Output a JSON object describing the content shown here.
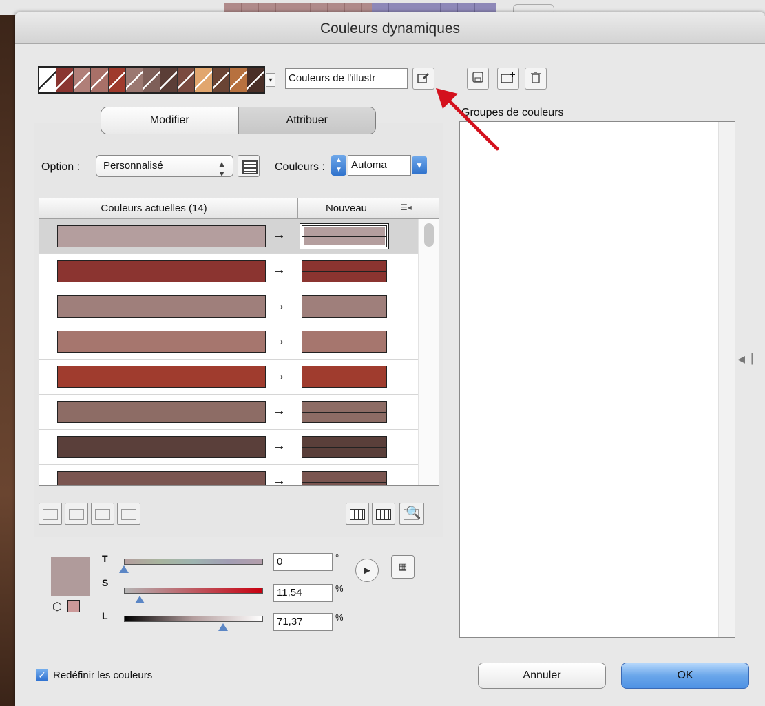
{
  "window": {
    "title": "Couleurs dynamiques"
  },
  "swatches": [
    "#ffffff",
    "#8a3530",
    "#b07f78",
    "#a87068",
    "#9f3a2c",
    "#9b7871",
    "#7e5f59",
    "#5b3e37",
    "#7a4a3f",
    "#e1a66e",
    "#6a4434",
    "#b7713f",
    "#4a2f27"
  ],
  "toolbar": {
    "name_value": "Couleurs de l'illustr",
    "dropdown_glyph": "▾",
    "icons": [
      "eyedropper-icon",
      "save-icon",
      "new-folder-icon",
      "trash-icon"
    ]
  },
  "groups": {
    "label": "Groupes de couleurs"
  },
  "tabs": {
    "edit": "Modifier",
    "assign": "Attribuer"
  },
  "options": {
    "option_label": "Option :",
    "option_value": "Personnalisé",
    "couleurs_label": "Couleurs :",
    "couleurs_value": "Automa"
  },
  "table": {
    "col_current": "Couleurs actuelles (14)",
    "col_new": "Nouveau",
    "arrow_glyph": "→",
    "rows": [
      {
        "current": "#b49e9e",
        "new": "#b49e9e"
      },
      {
        "current": "#8b3430",
        "new": "#8b3430"
      },
      {
        "current": "#9f7f7b",
        "new": "#9f7f7b"
      },
      {
        "current": "#a6766e",
        "new": "#a6766e"
      },
      {
        "current": "#a03c2e",
        "new": "#a03c2e"
      },
      {
        "current": "#8d6c65",
        "new": "#8d6c65"
      },
      {
        "current": "#5a3f3a",
        "new": "#5a3f3a"
      },
      {
        "current": "#7a5550",
        "new": "#7a5550"
      }
    ]
  },
  "hsl": {
    "t_label": "T",
    "t_value": "0",
    "t_unit": "°",
    "t_level": 0.0,
    "s_label": "S",
    "s_value": "11,54",
    "s_unit": "%",
    "s_level": 0.1154,
    "l_label": "L",
    "l_value": "71,37",
    "l_unit": "%",
    "l_level": 0.7137
  },
  "footer": {
    "redefine_label": "Redéfinir les couleurs",
    "redefine_checked": true,
    "cancel_label": "Annuler",
    "ok_label": "OK"
  }
}
